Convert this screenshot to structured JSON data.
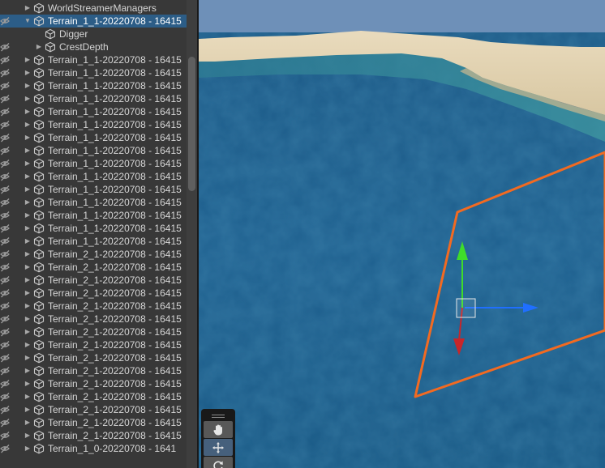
{
  "hierarchy": {
    "rows": [
      {
        "label": "WorldStreamerManagers",
        "depth": 0,
        "expanded": false,
        "selected": false,
        "hidden_icon": false
      },
      {
        "label": "Terrain_1_1-20220708 - 16415",
        "depth": 0,
        "expanded": true,
        "selected": true,
        "hidden_icon": true
      },
      {
        "label": "Digger",
        "depth": 1,
        "expanded": null,
        "selected": false,
        "hidden_icon": false
      },
      {
        "label": "CrestDepth",
        "depth": 1,
        "expanded": false,
        "selected": false,
        "hidden_icon": true
      },
      {
        "label": "Terrain_1_1-20220708 - 16415",
        "depth": 0,
        "expanded": false,
        "selected": false,
        "hidden_icon": true
      },
      {
        "label": "Terrain_1_1-20220708 - 16415",
        "depth": 0,
        "expanded": false,
        "selected": false,
        "hidden_icon": true
      },
      {
        "label": "Terrain_1_1-20220708 - 16415",
        "depth": 0,
        "expanded": false,
        "selected": false,
        "hidden_icon": true
      },
      {
        "label": "Terrain_1_1-20220708 - 16415",
        "depth": 0,
        "expanded": false,
        "selected": false,
        "hidden_icon": true
      },
      {
        "label": "Terrain_1_1-20220708 - 16415",
        "depth": 0,
        "expanded": false,
        "selected": false,
        "hidden_icon": true
      },
      {
        "label": "Terrain_1_1-20220708 - 16415",
        "depth": 0,
        "expanded": false,
        "selected": false,
        "hidden_icon": true
      },
      {
        "label": "Terrain_1_1-20220708 - 16415",
        "depth": 0,
        "expanded": false,
        "selected": false,
        "hidden_icon": true
      },
      {
        "label": "Terrain_1_1-20220708 - 16415",
        "depth": 0,
        "expanded": false,
        "selected": false,
        "hidden_icon": true
      },
      {
        "label": "Terrain_1_1-20220708 - 16415",
        "depth": 0,
        "expanded": false,
        "selected": false,
        "hidden_icon": true
      },
      {
        "label": "Terrain_1_1-20220708 - 16415",
        "depth": 0,
        "expanded": false,
        "selected": false,
        "hidden_icon": true
      },
      {
        "label": "Terrain_1_1-20220708 - 16415",
        "depth": 0,
        "expanded": false,
        "selected": false,
        "hidden_icon": true
      },
      {
        "label": "Terrain_1_1-20220708 - 16415",
        "depth": 0,
        "expanded": false,
        "selected": false,
        "hidden_icon": true
      },
      {
        "label": "Terrain_1_1-20220708 - 16415",
        "depth": 0,
        "expanded": false,
        "selected": false,
        "hidden_icon": true
      },
      {
        "label": "Terrain_1_1-20220708 - 16415",
        "depth": 0,
        "expanded": false,
        "selected": false,
        "hidden_icon": true
      },
      {
        "label": "Terrain_1_1-20220708 - 16415",
        "depth": 0,
        "expanded": false,
        "selected": false,
        "hidden_icon": true
      },
      {
        "label": "Terrain_2_1-20220708 - 16415",
        "depth": 0,
        "expanded": false,
        "selected": false,
        "hidden_icon": true
      },
      {
        "label": "Terrain_2_1-20220708 - 16415",
        "depth": 0,
        "expanded": false,
        "selected": false,
        "hidden_icon": true
      },
      {
        "label": "Terrain_2_1-20220708 - 16415",
        "depth": 0,
        "expanded": false,
        "selected": false,
        "hidden_icon": true
      },
      {
        "label": "Terrain_2_1-20220708 - 16415",
        "depth": 0,
        "expanded": false,
        "selected": false,
        "hidden_icon": true
      },
      {
        "label": "Terrain_2_1-20220708 - 16415",
        "depth": 0,
        "expanded": false,
        "selected": false,
        "hidden_icon": true
      },
      {
        "label": "Terrain_2_1-20220708 - 16415",
        "depth": 0,
        "expanded": false,
        "selected": false,
        "hidden_icon": true
      },
      {
        "label": "Terrain_2_1-20220708 - 16415",
        "depth": 0,
        "expanded": false,
        "selected": false,
        "hidden_icon": true
      },
      {
        "label": "Terrain_2_1-20220708 - 16415",
        "depth": 0,
        "expanded": false,
        "selected": false,
        "hidden_icon": true
      },
      {
        "label": "Terrain_2_1-20220708 - 16415",
        "depth": 0,
        "expanded": false,
        "selected": false,
        "hidden_icon": true
      },
      {
        "label": "Terrain_2_1-20220708 - 16415",
        "depth": 0,
        "expanded": false,
        "selected": false,
        "hidden_icon": true
      },
      {
        "label": "Terrain_2_1-20220708 - 16415",
        "depth": 0,
        "expanded": false,
        "selected": false,
        "hidden_icon": true
      },
      {
        "label": "Terrain_2_1-20220708 - 16415",
        "depth": 0,
        "expanded": false,
        "selected": false,
        "hidden_icon": true
      },
      {
        "label": "Terrain_2_1-20220708 - 16415",
        "depth": 0,
        "expanded": false,
        "selected": false,
        "hidden_icon": true
      },
      {
        "label": "Terrain_2_1-20220708 - 16415",
        "depth": 0,
        "expanded": false,
        "selected": false,
        "hidden_icon": true
      },
      {
        "label": "Terrain_2_1-20220708 - 16415",
        "depth": 0,
        "expanded": false,
        "selected": false,
        "hidden_icon": true
      },
      {
        "label": "Terrain_1_0-20220708 - 1641",
        "depth": 0,
        "expanded": false,
        "selected": false,
        "hidden_icon": true
      }
    ]
  },
  "icons": {
    "visibility": "hidden-eye-icon",
    "gameobject": "cube-icon",
    "hand_tool": "hand-icon",
    "move_tool": "move-arrows-icon",
    "rotate_tool": "rotate-icon"
  },
  "tools": {
    "active": "move"
  },
  "colors": {
    "panel_bg": "#383838",
    "selected_row": "#2c5d87",
    "ocean": "#1f5c86",
    "sand": "#e2d2b0",
    "sky": "#6c8fb8",
    "outline": "#f26a21",
    "gizmo_x": "#1f6fff",
    "gizmo_y": "#3fdc2a",
    "gizmo_z": "#c8262a"
  }
}
